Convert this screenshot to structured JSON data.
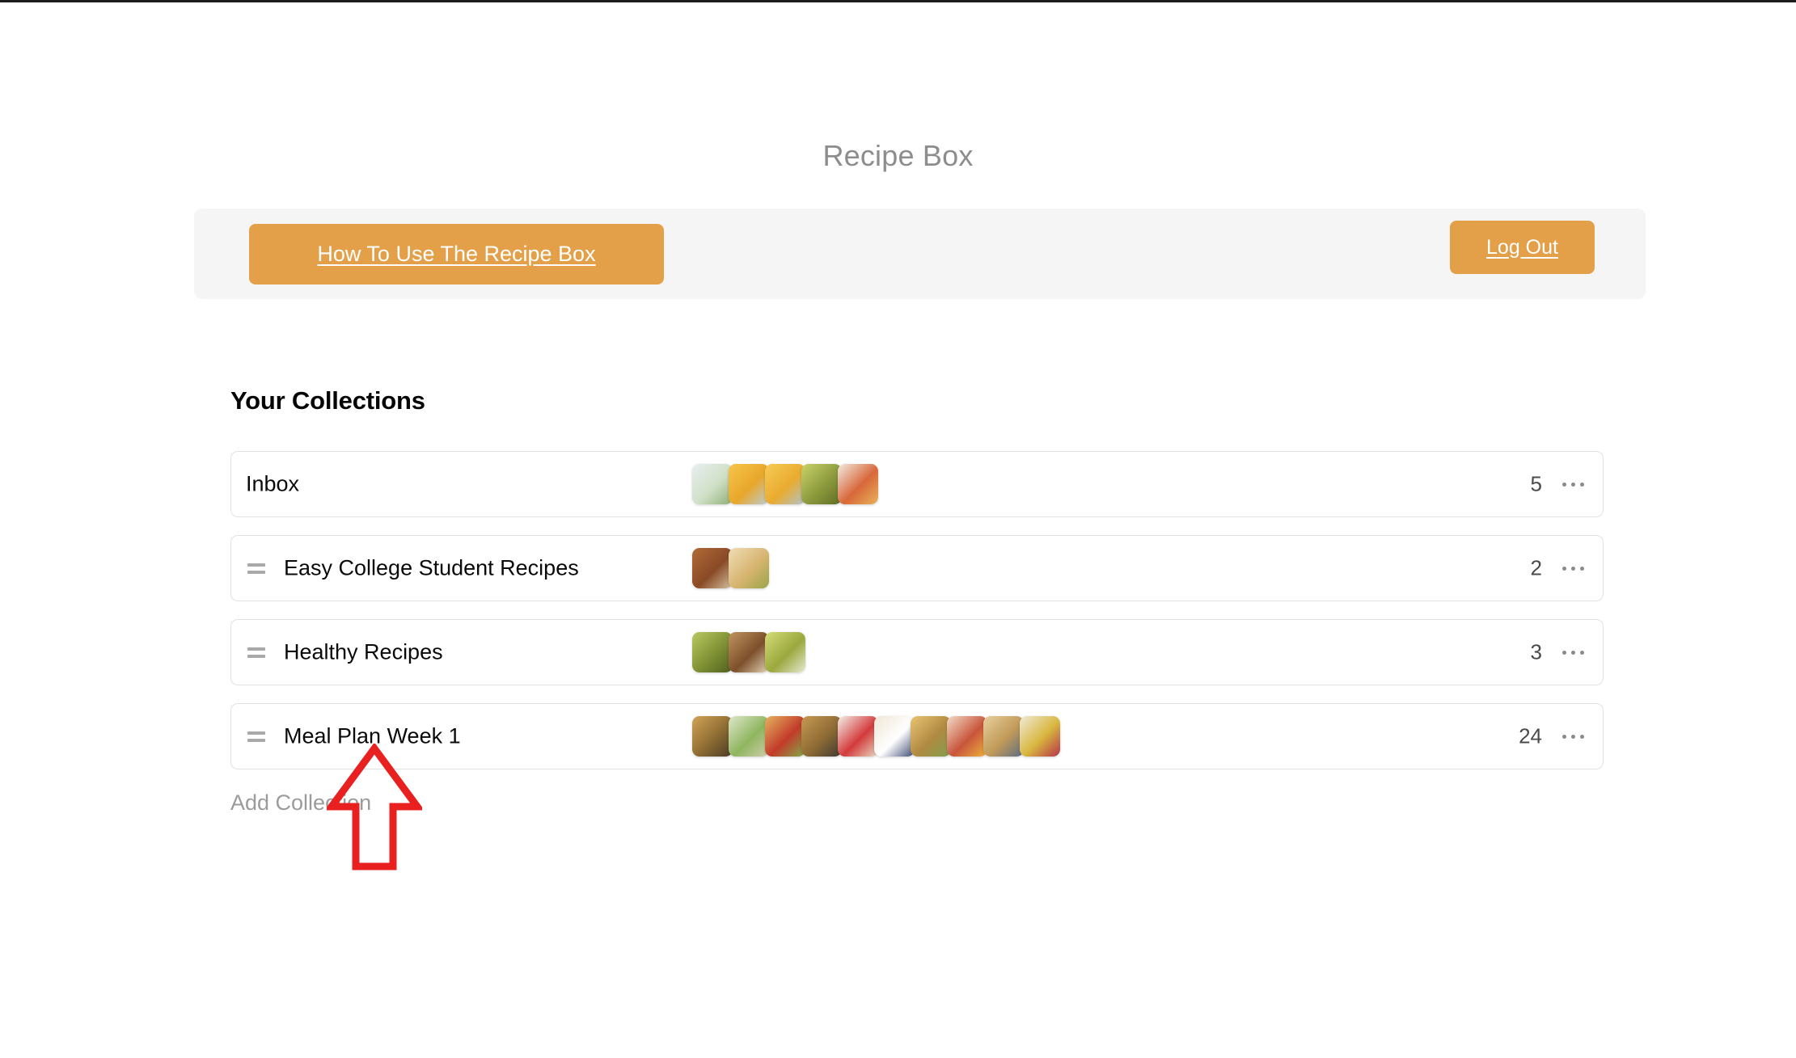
{
  "page": {
    "title": "Recipe Box"
  },
  "toolbar": {
    "how_to_label": "How To Use The Recipe Box",
    "logout_label": "Log Out",
    "button_color": "#e3a049",
    "background_color": "#f5f5f5"
  },
  "collections_section": {
    "heading": "Your Collections",
    "add_collection_label": "Add Collection",
    "rows": [
      {
        "name": "Inbox",
        "count": "5",
        "has_drag_handle": false,
        "menu_icon": "ellipsis-icon",
        "thumbnails": [
          {
            "name": "chicken-salad-bowl-thumbnail",
            "colors": [
              "#e9eef0",
              "#cfe0c7",
              "#8fae74"
            ]
          },
          {
            "name": "orange-juice-glass-thumbnail",
            "colors": [
              "#f6c54a",
              "#e8a72b",
              "#b9cdd6"
            ]
          },
          {
            "name": "orange-juice-glass-thumbnail",
            "colors": [
              "#f7cb55",
              "#e9ab2f",
              "#aec4cf"
            ]
          },
          {
            "name": "brussels-sprouts-thumbnail",
            "colors": [
              "#c8d26a",
              "#8c9a3c",
              "#5d6b27"
            ]
          },
          {
            "name": "roasted-plate-thumbnail",
            "colors": [
              "#f2ece2",
              "#d8683a",
              "#e8b35a"
            ]
          }
        ]
      },
      {
        "name": "Easy College Student Recipes",
        "count": "2",
        "has_drag_handle": true,
        "menu_icon": "ellipsis-icon",
        "thumbnails": [
          {
            "name": "chili-skillet-thumbnail",
            "colors": [
              "#b06a38",
              "#8a4a26",
              "#d5c4a3"
            ]
          },
          {
            "name": "flatbread-pizza-thumbnail",
            "colors": [
              "#f0ddb6",
              "#d7b470",
              "#9aa548"
            ]
          }
        ]
      },
      {
        "name": "Healthy Recipes",
        "count": "3",
        "has_drag_handle": true,
        "menu_icon": "ellipsis-icon",
        "thumbnails": [
          {
            "name": "brussels-sprouts-bowl-thumbnail",
            "colors": [
              "#b9c861",
              "#7e9033",
              "#4f5f1f"
            ]
          },
          {
            "name": "pulled-pork-thumbnail",
            "colors": [
              "#c09560",
              "#7d4f2b",
              "#e4d5b8"
            ]
          },
          {
            "name": "shaved-brussels-salad-thumbnail",
            "colors": [
              "#d5dd7a",
              "#9aa83d",
              "#e7e9d0"
            ]
          }
        ]
      },
      {
        "name": "Meal Plan Week 1",
        "count": "24",
        "has_drag_handle": true,
        "menu_icon": "ellipsis-icon",
        "thumbnails": [
          {
            "name": "granola-clusters-thumbnail",
            "colors": [
              "#d2a457",
              "#8c6b32",
              "#4a3a28"
            ]
          },
          {
            "name": "lettuce-wraps-thumbnail",
            "colors": [
              "#dfe8cc",
              "#8fb55f",
              "#d2cfae"
            ]
          },
          {
            "name": "cheeseburger-thumbnail",
            "colors": [
              "#e6b25f",
              "#c23b2a",
              "#7fae4a"
            ]
          },
          {
            "name": "oatmeal-bake-thumbnail",
            "colors": [
              "#c69a54",
              "#8d6a33",
              "#3e3a33"
            ]
          },
          {
            "name": "yogurt-parfait-thumbnail",
            "colors": [
              "#f4f1e9",
              "#d43a3c",
              "#e7dcc2"
            ]
          },
          {
            "name": "oatmeal-blueberries-thumbnail",
            "colors": [
              "#efe6d6",
              "#ffffff",
              "#3e4a74"
            ]
          },
          {
            "name": "egg-muffins-thumbnail",
            "colors": [
              "#e9c473",
              "#b08941",
              "#7fa04c"
            ]
          },
          {
            "name": "bacon-egg-sandwich-thumbnail",
            "colors": [
              "#f3dcc6",
              "#c8553c",
              "#f0b53b"
            ]
          },
          {
            "name": "pancake-stack-thumbnail",
            "colors": [
              "#e9cf9e",
              "#c09a58",
              "#5b6a86"
            ]
          },
          {
            "name": "fruit-salad-thumbnail",
            "colors": [
              "#f0ead8",
              "#d8b63e",
              "#b5324a"
            ]
          }
        ]
      }
    ]
  },
  "annotation": {
    "arrow_name": "red-up-arrow-annotation",
    "arrow_color": "#e8201f",
    "points_at": "Meal Plan Week 1"
  }
}
